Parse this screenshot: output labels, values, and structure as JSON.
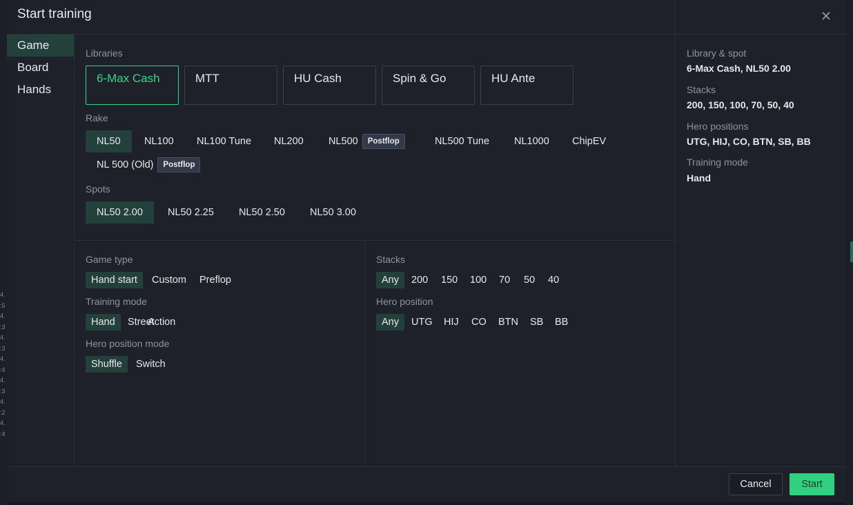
{
  "dialog": {
    "title": "Start training"
  },
  "nav": {
    "items": [
      {
        "label": "Game"
      },
      {
        "label": "Board"
      },
      {
        "label": "Hands"
      }
    ]
  },
  "libraries": {
    "label": "Libraries",
    "items": [
      {
        "label": "6-Max Cash"
      },
      {
        "label": "MTT"
      },
      {
        "label": "HU Cash"
      },
      {
        "label": "Spin & Go"
      },
      {
        "label": "HU Ante"
      }
    ]
  },
  "rake": {
    "label": "Rake",
    "items": [
      {
        "label": "NL50"
      },
      {
        "label": "NL100"
      },
      {
        "label": "NL100 Tune"
      },
      {
        "label": "NL200"
      },
      {
        "label": "NL500",
        "badge": "Postflop"
      },
      {
        "label": "NL500 Tune"
      },
      {
        "label": "NL1000"
      },
      {
        "label": "ChipEV"
      },
      {
        "label": "NL 500 (Old)",
        "badge": "Postflop"
      }
    ]
  },
  "spots": {
    "label": "Spots",
    "items": [
      {
        "label": "NL50 2.00"
      },
      {
        "label": "NL50 2.25"
      },
      {
        "label": "NL50 2.50"
      },
      {
        "label": "NL50 3.00"
      }
    ]
  },
  "game_type": {
    "label": "Game type",
    "options": [
      "Hand start",
      "Custom",
      "Preflop"
    ]
  },
  "training_mode": {
    "label": "Training mode",
    "options": [
      "Hand",
      "Street",
      "Action"
    ]
  },
  "hero_position_mode": {
    "label": "Hero position mode",
    "options": [
      "Shuffle",
      "Switch"
    ]
  },
  "stacks": {
    "label": "Stacks",
    "options": [
      "Any",
      "200",
      "150",
      "100",
      "70",
      "50",
      "40"
    ]
  },
  "hero_position": {
    "label": "Hero position",
    "options": [
      "Any",
      "UTG",
      "HIJ",
      "CO",
      "BTN",
      "SB",
      "BB"
    ]
  },
  "summary": {
    "library_spot_label": "Library & spot",
    "library_spot_value": "6-Max Cash, NL50 2.00",
    "stacks_label": "Stacks",
    "stacks_value": "200, 150, 100, 70, 50, 40",
    "hero_positions_label": "Hero positions",
    "hero_positions_value": "UTG, HIJ, CO, BTN, SB, BB",
    "training_mode_label": "Training mode",
    "training_mode_value": "Hand"
  },
  "footer": {
    "cancel_label": "Cancel",
    "start_label": "Start"
  },
  "background_digits": [
    "4.",
    ":5",
    "4.",
    ":3",
    "4.",
    ":3",
    "4.",
    ":4",
    "4.",
    ":3",
    "4.",
    ":2",
    "4.",
    ":4"
  ],
  "colors": {
    "accent": "#34d68a",
    "active_fill": "#24403a",
    "modal_bg": "#1e212a",
    "start_button": "#2fd07f"
  },
  "icons": {
    "close": "close-icon"
  }
}
